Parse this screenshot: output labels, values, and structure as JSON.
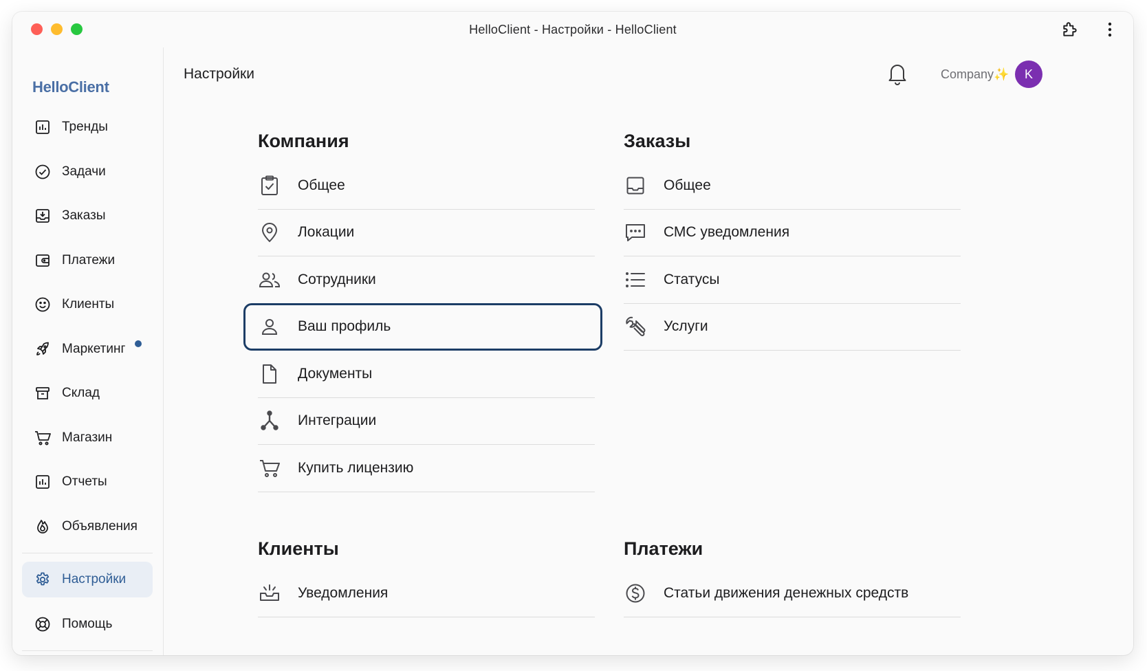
{
  "window": {
    "title": "HelloClient - Настройки - HelloClient"
  },
  "sidebar": {
    "brand": "HelloClient",
    "items": [
      {
        "label": "Тренды",
        "icon": "chart-icon"
      },
      {
        "label": "Задачи",
        "icon": "check-circle-icon"
      },
      {
        "label": "Заказы",
        "icon": "inbox-download-icon"
      },
      {
        "label": "Платежи",
        "icon": "wallet-icon"
      },
      {
        "label": "Клиенты",
        "icon": "smile-icon"
      },
      {
        "label": "Маркетинг",
        "icon": "rocket-icon",
        "badge": "dot"
      },
      {
        "label": "Склад",
        "icon": "archive-icon"
      },
      {
        "label": "Магазин",
        "icon": "cart-icon"
      },
      {
        "label": "Отчеты",
        "icon": "chart-icon"
      },
      {
        "label": "Объявления",
        "icon": "fire-icon"
      },
      {
        "label": "Настройки",
        "icon": "gear-icon",
        "active": true
      },
      {
        "label": "Помощь",
        "icon": "lifebuoy-icon"
      }
    ]
  },
  "header": {
    "title": "Настройки",
    "company": "Company",
    "company_spark": "✨",
    "avatar_initial": "K"
  },
  "sections": {
    "company": {
      "title": "Компания",
      "items": [
        {
          "label": "Общее",
          "icon": "clipboard-check-icon"
        },
        {
          "label": "Локации",
          "icon": "map-pin-icon"
        },
        {
          "label": "Сотрудники",
          "icon": "users-icon"
        },
        {
          "label": "Ваш профиль",
          "icon": "user-icon",
          "selected": true
        },
        {
          "label": "Документы",
          "icon": "document-icon"
        },
        {
          "label": "Интеграции",
          "icon": "integration-icon"
        },
        {
          "label": "Купить лицензию",
          "icon": "cart-icon"
        }
      ]
    },
    "orders": {
      "title": "Заказы",
      "items": [
        {
          "label": "Общее",
          "icon": "inbox-icon"
        },
        {
          "label": "СМС уведомления",
          "icon": "message-icon"
        },
        {
          "label": "Статусы",
          "icon": "list-icon"
        },
        {
          "label": "Услуги",
          "icon": "wrench-icon"
        }
      ]
    },
    "clients": {
      "title": "Клиенты",
      "items": [
        {
          "label": "Уведомления",
          "icon": "notification-tray-icon"
        }
      ]
    },
    "payments": {
      "title": "Платежи",
      "items": [
        {
          "label": "Статьи движения денежных средств",
          "icon": "dollar-circle-icon"
        }
      ]
    }
  },
  "colors": {
    "accent": "#2f5d95",
    "brand": "#4a6fa5",
    "selected_ring": "#1c3d66",
    "avatar": "#7b2fb0"
  }
}
